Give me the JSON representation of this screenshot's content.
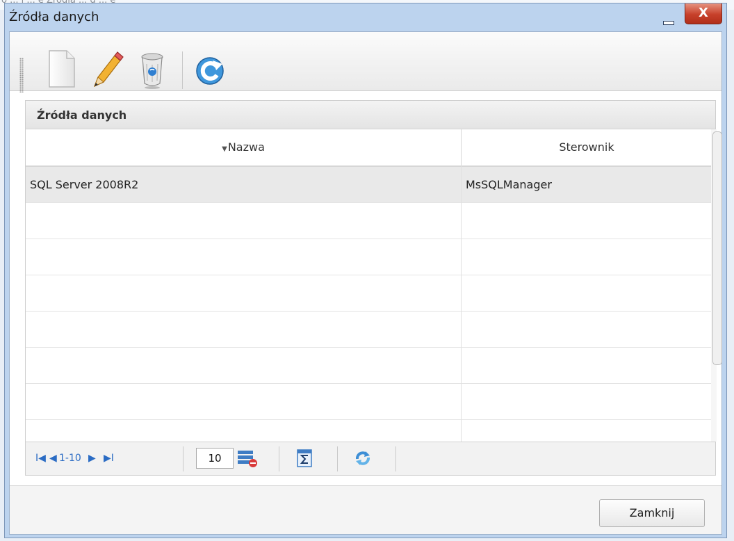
{
  "background": {
    "text": "o ... i ... e Źródła ... d ... e"
  },
  "window": {
    "title": "Źródła danych",
    "close_glyph": "X",
    "colors": {
      "frame": "#bcd3ee",
      "close": "#c7402a"
    }
  },
  "toolbar": {
    "buttons": [
      {
        "icon": "new-document-icon"
      },
      {
        "icon": "pencil-edit-icon"
      },
      {
        "icon": "recycle-bin-icon"
      },
      {
        "icon": "refresh-icon"
      }
    ]
  },
  "panel": {
    "title": "Źródła danych",
    "columns": [
      {
        "label": "Nazwa",
        "sorted": "desc"
      },
      {
        "label": "Sterownik"
      }
    ],
    "rows": [
      {
        "nazwa": "SQL Server 2008R2",
        "sterownik": "MsSQLManager",
        "selected": true
      },
      {
        "nazwa": "",
        "sterownik": ""
      },
      {
        "nazwa": "",
        "sterownik": ""
      },
      {
        "nazwa": "",
        "sterownik": ""
      },
      {
        "nazwa": "",
        "sterownik": ""
      },
      {
        "nazwa": "",
        "sterownik": ""
      },
      {
        "nazwa": "",
        "sterownik": ""
      },
      {
        "nazwa": "",
        "sterownik": ""
      }
    ]
  },
  "pager": {
    "first_glyph": "I◀",
    "prev_glyph": "◀",
    "range": "1-10",
    "next_glyph": "▶",
    "last_glyph": "▶I",
    "page_size": "10",
    "icons": [
      "page-size-grid-icon",
      "sum-icon",
      "refresh-grid-icon"
    ],
    "link_color": "#2b6cc4"
  },
  "footer": {
    "close_label": "Zamknij"
  }
}
